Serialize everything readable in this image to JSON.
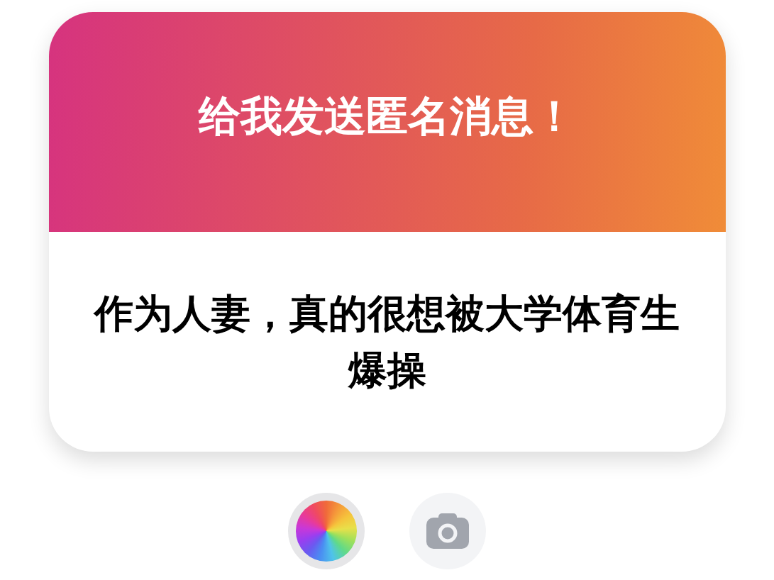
{
  "card": {
    "title": "给我发送匿名消息！",
    "message": "作为人妻，真的很想被大学体育生爆操"
  },
  "tools": [
    {
      "kind": "color-wheel"
    },
    {
      "kind": "camera"
    }
  ]
}
